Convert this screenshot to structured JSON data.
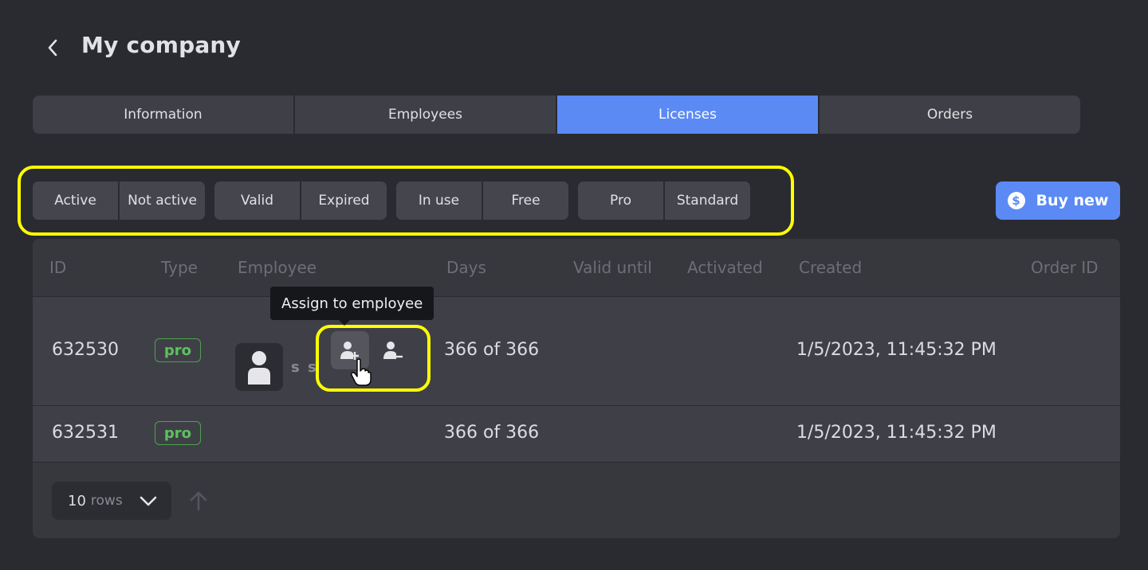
{
  "header": {
    "title": "My company",
    "back_icon": "chevron-left-icon"
  },
  "tabs": [
    {
      "label": "Information",
      "active": false
    },
    {
      "label": "Employees",
      "active": false
    },
    {
      "label": "Licenses",
      "active": true
    },
    {
      "label": "Orders",
      "active": false
    }
  ],
  "filters": {
    "groups": [
      [
        "Active",
        "Not active"
      ],
      [
        "Valid",
        "Expired"
      ],
      [
        "In use",
        "Free"
      ],
      [
        "Pro",
        "Standard"
      ]
    ]
  },
  "buy_button": {
    "label": "Buy new",
    "icon": "dollar-coin-icon"
  },
  "table": {
    "columns": [
      "ID",
      "Type",
      "Employee",
      "Days",
      "Valid until",
      "Activated",
      "Created",
      "Order ID"
    ],
    "rows": [
      {
        "id": "632530",
        "type": "pro",
        "employee": "s s",
        "days": "366 of 366",
        "valid_until": "",
        "activated": "",
        "created": "1/5/2023, 11:45:32 PM",
        "order_id": ""
      },
      {
        "id": "632531",
        "type": "pro",
        "employee": "",
        "days": "366 of 366",
        "valid_until": "",
        "activated": "",
        "created": "1/5/2023, 11:45:32 PM",
        "order_id": ""
      }
    ],
    "tooltip": "Assign to employee"
  },
  "pagination": {
    "rows_value": "10",
    "rows_word": "rows"
  },
  "colors": {
    "accent": "#5b8af5",
    "background": "#2a2b30",
    "highlight": "#ffff00",
    "pro_badge": "#5cc25c"
  }
}
